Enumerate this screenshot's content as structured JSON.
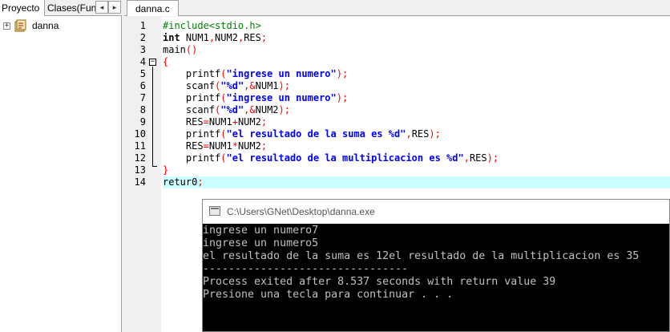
{
  "left_panel": {
    "tabs": [
      {
        "label": "Proyecto"
      },
      {
        "label": "Clases(Fun"
      }
    ],
    "scroll_left": "◂",
    "scroll_right": "▸",
    "tree": [
      {
        "expander": "+",
        "icon": "project-icon",
        "label": "danna"
      }
    ]
  },
  "editor": {
    "tab_label": "danna.c",
    "fold_marker": "−",
    "lines": [
      {
        "num": "1",
        "tokens": [
          {
            "t": "#include<stdio.h>",
            "c": "pre"
          }
        ]
      },
      {
        "num": "2",
        "tokens": [
          {
            "t": "int",
            "c": "kw"
          },
          {
            "t": " NUM1",
            "c": ""
          },
          {
            "t": ",",
            "c": "sym"
          },
          {
            "t": "NUM2",
            "c": ""
          },
          {
            "t": ",",
            "c": "sym"
          },
          {
            "t": "RES",
            "c": ""
          },
          {
            "t": ";",
            "c": "sym"
          }
        ]
      },
      {
        "num": "3",
        "tokens": [
          {
            "t": "main",
            "c": ""
          },
          {
            "t": "()",
            "c": "sym"
          }
        ]
      },
      {
        "num": "4",
        "tokens": [
          {
            "t": "{",
            "c": "sym"
          }
        ]
      },
      {
        "num": "5",
        "tokens": [
          {
            "t": "    printf",
            "c": ""
          },
          {
            "t": "(",
            "c": "sym"
          },
          {
            "t": "\"ingrese un numero\"",
            "c": "str"
          },
          {
            "t": ");",
            "c": "sym"
          }
        ]
      },
      {
        "num": "6",
        "tokens": [
          {
            "t": "    scanf",
            "c": ""
          },
          {
            "t": "(",
            "c": "sym"
          },
          {
            "t": "\"%d\"",
            "c": "str"
          },
          {
            "t": ",&",
            "c": "sym"
          },
          {
            "t": "NUM1",
            "c": ""
          },
          {
            "t": ");",
            "c": "sym"
          }
        ]
      },
      {
        "num": "7",
        "tokens": [
          {
            "t": "    printf",
            "c": ""
          },
          {
            "t": "(",
            "c": "sym"
          },
          {
            "t": "\"ingrese un numero\"",
            "c": "str"
          },
          {
            "t": ");",
            "c": "sym"
          }
        ]
      },
      {
        "num": "8",
        "tokens": [
          {
            "t": "    scanf",
            "c": ""
          },
          {
            "t": "(",
            "c": "sym"
          },
          {
            "t": "\"%d\"",
            "c": "str"
          },
          {
            "t": ",&",
            "c": "sym"
          },
          {
            "t": "NUM2",
            "c": ""
          },
          {
            "t": ");",
            "c": "sym"
          }
        ]
      },
      {
        "num": "9",
        "tokens": [
          {
            "t": "    RES",
            "c": ""
          },
          {
            "t": "=",
            "c": "sym"
          },
          {
            "t": "NUM1",
            "c": ""
          },
          {
            "t": "+",
            "c": "sym"
          },
          {
            "t": "NUM2",
            "c": ""
          },
          {
            "t": ";",
            "c": "sym"
          }
        ]
      },
      {
        "num": "10",
        "tokens": [
          {
            "t": "    printf",
            "c": ""
          },
          {
            "t": "(",
            "c": "sym"
          },
          {
            "t": "\"el resultado de la suma es %d\"",
            "c": "str"
          },
          {
            "t": ",",
            "c": "sym"
          },
          {
            "t": "RES",
            "c": ""
          },
          {
            "t": ");",
            "c": "sym"
          }
        ]
      },
      {
        "num": "11",
        "tokens": [
          {
            "t": "    RES",
            "c": ""
          },
          {
            "t": "=",
            "c": "sym"
          },
          {
            "t": "NUM1",
            "c": ""
          },
          {
            "t": "*",
            "c": "sym"
          },
          {
            "t": "NUM2",
            "c": ""
          },
          {
            "t": ";",
            "c": "sym"
          }
        ]
      },
      {
        "num": "12",
        "tokens": [
          {
            "t": "    printf",
            "c": ""
          },
          {
            "t": "(",
            "c": "sym"
          },
          {
            "t": "\"el resultado de la multiplicacion es %d\"",
            "c": "str"
          },
          {
            "t": ",",
            "c": "sym"
          },
          {
            "t": "RES",
            "c": ""
          },
          {
            "t": ");",
            "c": "sym"
          }
        ]
      },
      {
        "num": "13",
        "tokens": [
          {
            "t": "}",
            "c": "sym"
          }
        ]
      },
      {
        "num": "14",
        "tokens": [
          {
            "t": "retur0",
            "c": ""
          },
          {
            "t": ";",
            "c": "sym"
          }
        ],
        "current": true
      }
    ]
  },
  "console": {
    "title": "C:\\Users\\GNet\\Desktop\\danna.exe",
    "lines": [
      "ingrese un numero7",
      "ingrese un numero5",
      "el resultado de la suma es 12el resultado de la multiplicacion es 35",
      "--------------------------------",
      "Process exited after 8.537 seconds with return value 39",
      "Presione una tecla para continuar . . ."
    ]
  },
  "colors": {
    "preprocessor": "#008000",
    "symbol": "#ff0000",
    "string": "#0000ff",
    "current_line": "#ccffff"
  }
}
